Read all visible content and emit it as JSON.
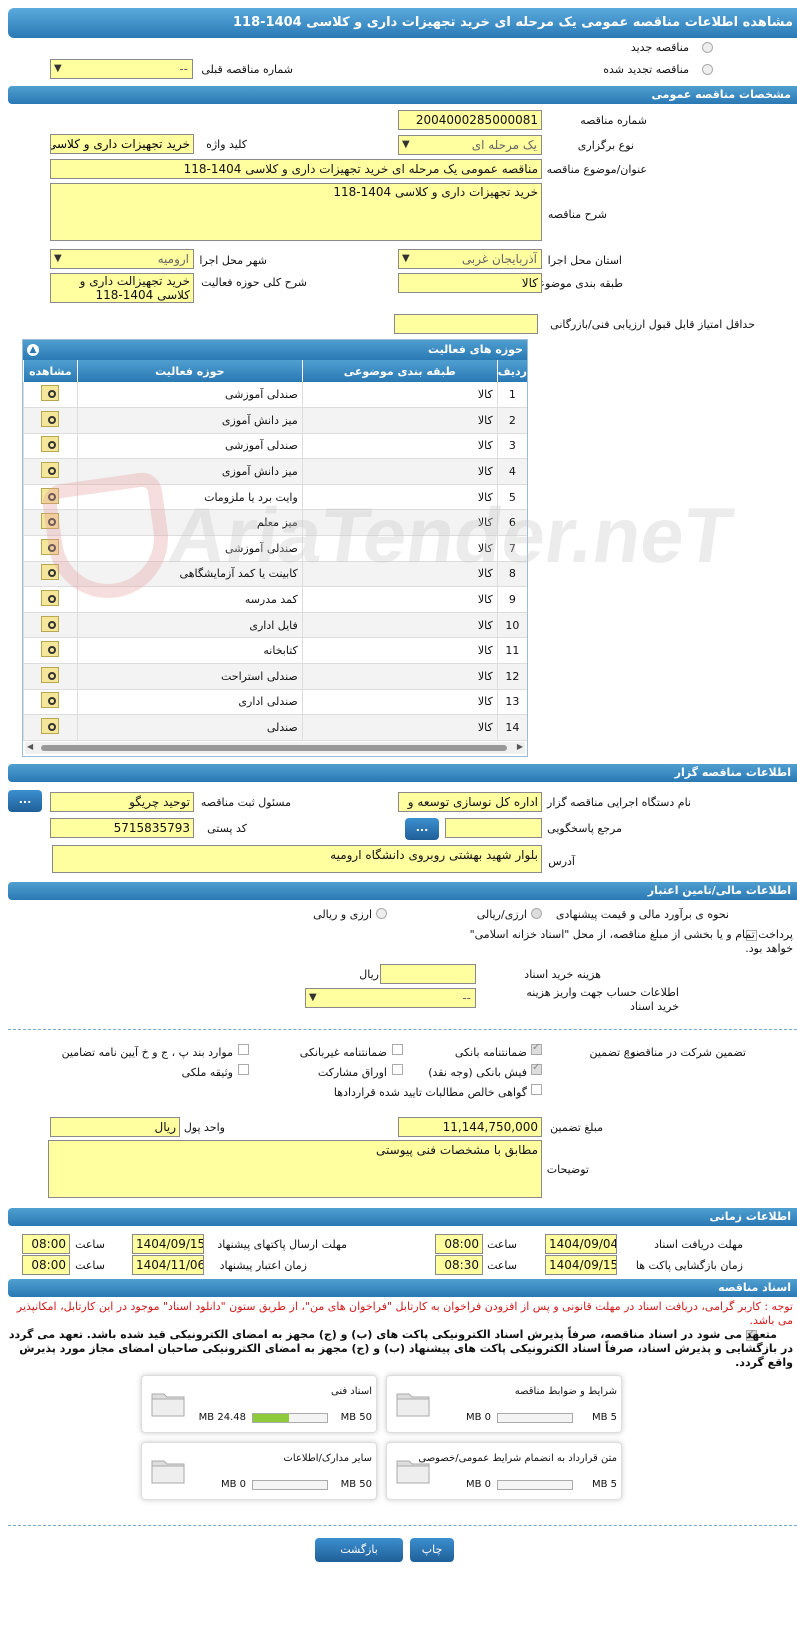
{
  "title": "مشاهده اطلاعات مناقصه عمومی یک مرحله ای خرید تجهیزات داری و کلاسی 1404-118",
  "top": {
    "new_label": "مناقصه جدید",
    "renew_label": "مناقصه تجدید شده",
    "prev_label": "شماره مناقصه قبلی",
    "prev_value": "--"
  },
  "general": {
    "header": "مشخصات مناقصه عمومی",
    "number_label": "شماره مناقصه",
    "number_value": "2004000285000081",
    "type_label": "نوع برگزاری",
    "type_value": "یک مرحله ای",
    "keyword_label": "کلید واژه",
    "keyword_value": "خرید تجهیزات داری و کلاسی",
    "subject_label": "عنوان/موضوع مناقصه",
    "subject_value": "مناقصه عمومی یک مرحله ای خرید تجهیزات داری و کلاسی 1404-118",
    "desc_label": "شرح مناقصه",
    "desc_value": "خرید تجهیزات داری و کلاسی 1404-118",
    "province_label": "استان محل اجرا",
    "province_value": "آذربایجان غربی",
    "city_label": "شهر محل اجرا",
    "city_value": "ارومیه",
    "category_label": "طبقه بندی موضوعی",
    "category_value": "کالا",
    "activity_label": "شرح کلی حوزه فعالیت",
    "activity_value": "خرید تجهیزالت داری و کلاسی 1404-118",
    "minscore_label": "حداقل امتیاز قابل قبول ارزیابی فنی/بازرگانی",
    "minscore_value": ""
  },
  "activities": {
    "header": "حوزه های فعالیت",
    "col_row": "ردیف",
    "col_cat": "طبقه بندی موضوعی",
    "col_field": "حوزه فعالیت",
    "col_view": "مشاهده",
    "rows": [
      {
        "n": "1",
        "cat": "کالا",
        "field": "صندلی آموزشی"
      },
      {
        "n": "2",
        "cat": "کالا",
        "field": "میز دانش آموزی"
      },
      {
        "n": "3",
        "cat": "کالا",
        "field": "صندلی آموزشی"
      },
      {
        "n": "4",
        "cat": "کالا",
        "field": "میز دانش آموزی"
      },
      {
        "n": "5",
        "cat": "کالا",
        "field": "وایت برد یا ملزومات"
      },
      {
        "n": "6",
        "cat": "کالا",
        "field": "میز معلم"
      },
      {
        "n": "7",
        "cat": "کالا",
        "field": "صندلی آموزشی"
      },
      {
        "n": "8",
        "cat": "کالا",
        "field": "کابینت یا کمد آزمایشگاهی"
      },
      {
        "n": "9",
        "cat": "کالا",
        "field": "کمد مدرسه"
      },
      {
        "n": "10",
        "cat": "کالا",
        "field": "فایل اداری"
      },
      {
        "n": "11",
        "cat": "کالا",
        "field": "کتابخانه"
      },
      {
        "n": "12",
        "cat": "کالا",
        "field": "صندلی استراحت"
      },
      {
        "n": "13",
        "cat": "کالا",
        "field": "صندلی اداری"
      },
      {
        "n": "14",
        "cat": "کالا",
        "field": "صندلی"
      }
    ]
  },
  "organizer": {
    "header": "اطلاعات مناقصه گزار",
    "org_label": "نام دستگاه اجرایی مناقصه گزار",
    "org_value": "اداره کل نوسازی   توسعه و",
    "resp_label": "مسئول ثبت مناقصه",
    "resp_value": "توحید چریگو",
    "ref_label": "مرجع پاسخگویی",
    "ref_value": "",
    "postal_label": "کد پستی",
    "postal_value": "5715835793",
    "addr_label": "آدرس",
    "addr_value": "بلوار شهید بهشتی روبروی دانشگاه ارومیه",
    "btn": "..."
  },
  "finance": {
    "header": "اطلاعات مالی/تامین اعتبار",
    "estimate_label": "نحوه ی برآورد مالی و قیمت پیشنهادی",
    "opt1": "ارزی/ریالی",
    "opt2": "ارزی و ریالی",
    "treasury_text": "پرداخت تمام و یا بخشی از مبلغ مناقصه، از محل \"اسناد خزانه اسلامی\" خواهد بود.",
    "doc_cost_label": "هزینه خرید اسناد",
    "doc_cost_value": "",
    "rial": "ریال",
    "account_label": "اطلاعات حساب جهت واریز هزینه خرید اسناد",
    "account_value": "--"
  },
  "guarantee": {
    "label": "تضمین شرکت در مناقصه:",
    "type_label": "نوع تضمین",
    "opt_bank": "ضمانتنامه بانکی",
    "opt_nonbank": "ضمانتنامه غیربانکی",
    "opt_items": "موارد بند پ ، ج و خ آیین نامه تضامین",
    "opt_cash": "فیش بانکی (وجه نقد)",
    "opt_bonds": "اوراق مشارکت",
    "opt_property": "وثیقه ملکی",
    "opt_cert": "گواهی خالص مطالبات تایید شده قراردادها",
    "amount_label": "مبلغ تضمین",
    "amount_value": "11,144,750,000",
    "unit_label": "واحد پول",
    "unit_value": "ریال",
    "notes_label": "توضیحات",
    "notes_value": "مطابق با مشخصات فنی پیوستی"
  },
  "timing": {
    "header": "اطلاعات زمانی",
    "receive_label": "مهلت دریافت اسناد",
    "receive_date": "1404/09/04",
    "receive_time": "08:00",
    "send_label": "مهلت ارسال پاکتهای پیشنهاد",
    "send_date": "1404/09/15",
    "send_time": "08:00",
    "open_label": "زمان بازگشایی پاکت ها",
    "open_date": "1404/09/15",
    "open_time": "08:30",
    "valid_label": "زمان اعتبار پیشنهاد",
    "valid_date": "1404/11/06",
    "valid_time": "08:00",
    "time_label": "ساعت"
  },
  "docs": {
    "header": "اسناد مناقصه",
    "notice": "توجه : کاربر گرامی، دریافت اسناد در مهلت قانونی و پس از افزودن فراخوان به کارتابل \"فراخوان های من\"، از طریق ستون \"دانلود اسناد\" موجود در این کارتابل، امکانپذیر می باشد.",
    "commit": "متعهد می شود در اسناد مناقصه، صرفاً پذیرش اسناد الکترونیکی پاکت های (ب) و (ج) مجهز به امضای الکترونیکی قید شده باشد. تعهد می گردد در بازگشایی و پذیرش اسناد، صرفاً اسناد الکترونیکی پاکت های پیشنهاد (ب) و (ج) مجهز به امضای الکترونیکی صاحبان امضای مجاز مورد پذیرش واقع گردد.",
    "files": [
      {
        "name": "شرایط و ضوابط مناقصه",
        "used": "0 MB",
        "max": "5 MB",
        "fraction": 0
      },
      {
        "name": "اسناد فنی",
        "used": "24.48 MB",
        "max": "50 MB",
        "fraction": 0.49
      },
      {
        "name": "متن قرارداد به انضمام شرایط عمومی/خصوصی",
        "used": "0 MB",
        "max": "5 MB",
        "fraction": 0
      },
      {
        "name": "سایر مدارک/اطلاعات",
        "used": "0 MB",
        "max": "50 MB",
        "fraction": 0
      }
    ]
  },
  "buttons": {
    "print": "چاپ",
    "back": "بازگشت"
  },
  "watermark": "AriaTender.neT"
}
